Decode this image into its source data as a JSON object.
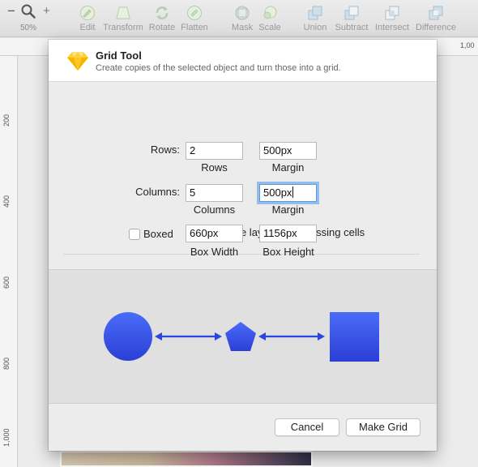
{
  "toolbar": {
    "zoom": {
      "minus": "−",
      "plus": "+",
      "level": "50%"
    },
    "tools": [
      {
        "label": "Edit",
        "icon": "edit-icon"
      },
      {
        "label": "Transform",
        "icon": "transform-icon"
      },
      {
        "label": "Rotate",
        "icon": "rotate-icon"
      },
      {
        "label": "Flatten",
        "icon": "flatten-icon"
      },
      {
        "label": "Mask",
        "icon": "mask-icon"
      },
      {
        "label": "Scale",
        "icon": "scale-icon"
      },
      {
        "label": "Union",
        "icon": "union-icon"
      },
      {
        "label": "Subtract",
        "icon": "subtract-icon"
      },
      {
        "label": "Intersect",
        "icon": "intersect-icon"
      },
      {
        "label": "Difference",
        "icon": "difference-icon"
      }
    ]
  },
  "rulers": {
    "horizontal": [
      "1,00"
    ],
    "vertical": [
      "200",
      "400",
      "600",
      "800",
      "1,000"
    ]
  },
  "dialog": {
    "title": "Grid Tool",
    "subtitle": "Create copies of the selected object and turn those into a grid.",
    "rows": {
      "label": "Rows:",
      "value": "2",
      "sublabel": "Rows",
      "margin_value": "500px",
      "margin_sublabel": "Margin"
    },
    "columns": {
      "label": "Columns:",
      "value": "5",
      "sublabel": "Columns",
      "margin_value": "500px",
      "margin_sublabel": "Margin"
    },
    "duplicate_layers": {
      "label": "Duplicate layers to fill missing cells",
      "checked": true
    },
    "boxed": {
      "label": "Boxed",
      "checked": false,
      "width_value": "660px",
      "width_sublabel": "Box Width",
      "height_value": "1156px",
      "height_sublabel": "Box Height"
    },
    "preview_shapes": [
      "circle",
      "pentagon",
      "square"
    ],
    "buttons": {
      "cancel": "Cancel",
      "confirm": "Make Grid"
    }
  },
  "colors": {
    "accent_blue": "#2d86f2",
    "shape_blue_top": "#4a6cf7",
    "shape_blue_bottom": "#2b3fd6",
    "arrow_blue": "#2b46e0",
    "sketch_gem": "#f7b500"
  }
}
